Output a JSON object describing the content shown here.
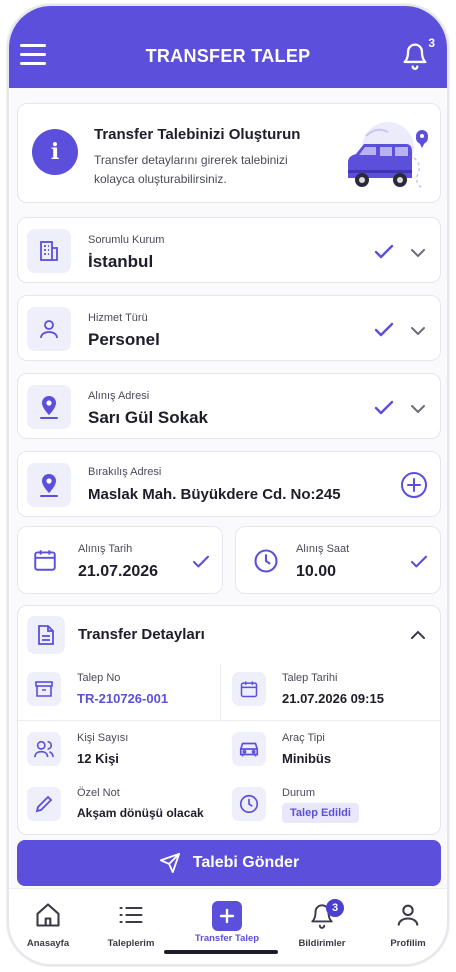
{
  "header": {
    "title": "TRANSFER TALEP",
    "notification_count": "3"
  },
  "info": {
    "title": "Transfer Talebinizi Oluşturun",
    "description": "Transfer detaylarını girerek talebinizi kolayca oluşturabilirsiniz."
  },
  "fields": {
    "kurum": {
      "label": "Sorumlu Kurum",
      "value": "İstanbul"
    },
    "hizmet": {
      "label": "Hizmet Türü",
      "value": "Personel"
    },
    "alinis": {
      "label": "Alınış Adresi",
      "value": "Sarı Gül Sokak"
    },
    "birakilis": {
      "label": "Bırakılış Adresi",
      "value": "Maslak Mah. Büyükdere Cd. No:245"
    }
  },
  "date": {
    "label": "Alınış Tarih",
    "value": "21.07.2026"
  },
  "time": {
    "label": "Alınış Saat",
    "value": "10.00"
  },
  "details": {
    "title": "Transfer Detayları",
    "talep_no": {
      "label": "Talep No",
      "value": "TR-210726-001"
    },
    "talep_tarihi": {
      "label": "Talep Tarihi",
      "value": "21.07.2026 09:15"
    },
    "kisi": {
      "label": "Kişi Sayısı",
      "value": "12 Kişi"
    },
    "arac": {
      "label": "Araç Tipi",
      "value": "Minibüs"
    },
    "not": {
      "label": "Özel Not",
      "value": "Akşam dönüşü olacak"
    },
    "durum": {
      "label": "Durum",
      "value": "Talep Edildi"
    }
  },
  "send_button": "Talebi Gönder",
  "tabs": [
    {
      "label": "Anasayfa"
    },
    {
      "label": "Taleplerim"
    },
    {
      "label": "Transfer Talep"
    },
    {
      "label": "Bildirimler",
      "badge": "3"
    },
    {
      "label": "Profilim"
    }
  ],
  "colors": {
    "accent": "#5b4fdc",
    "accent_light": "#efeefb"
  }
}
